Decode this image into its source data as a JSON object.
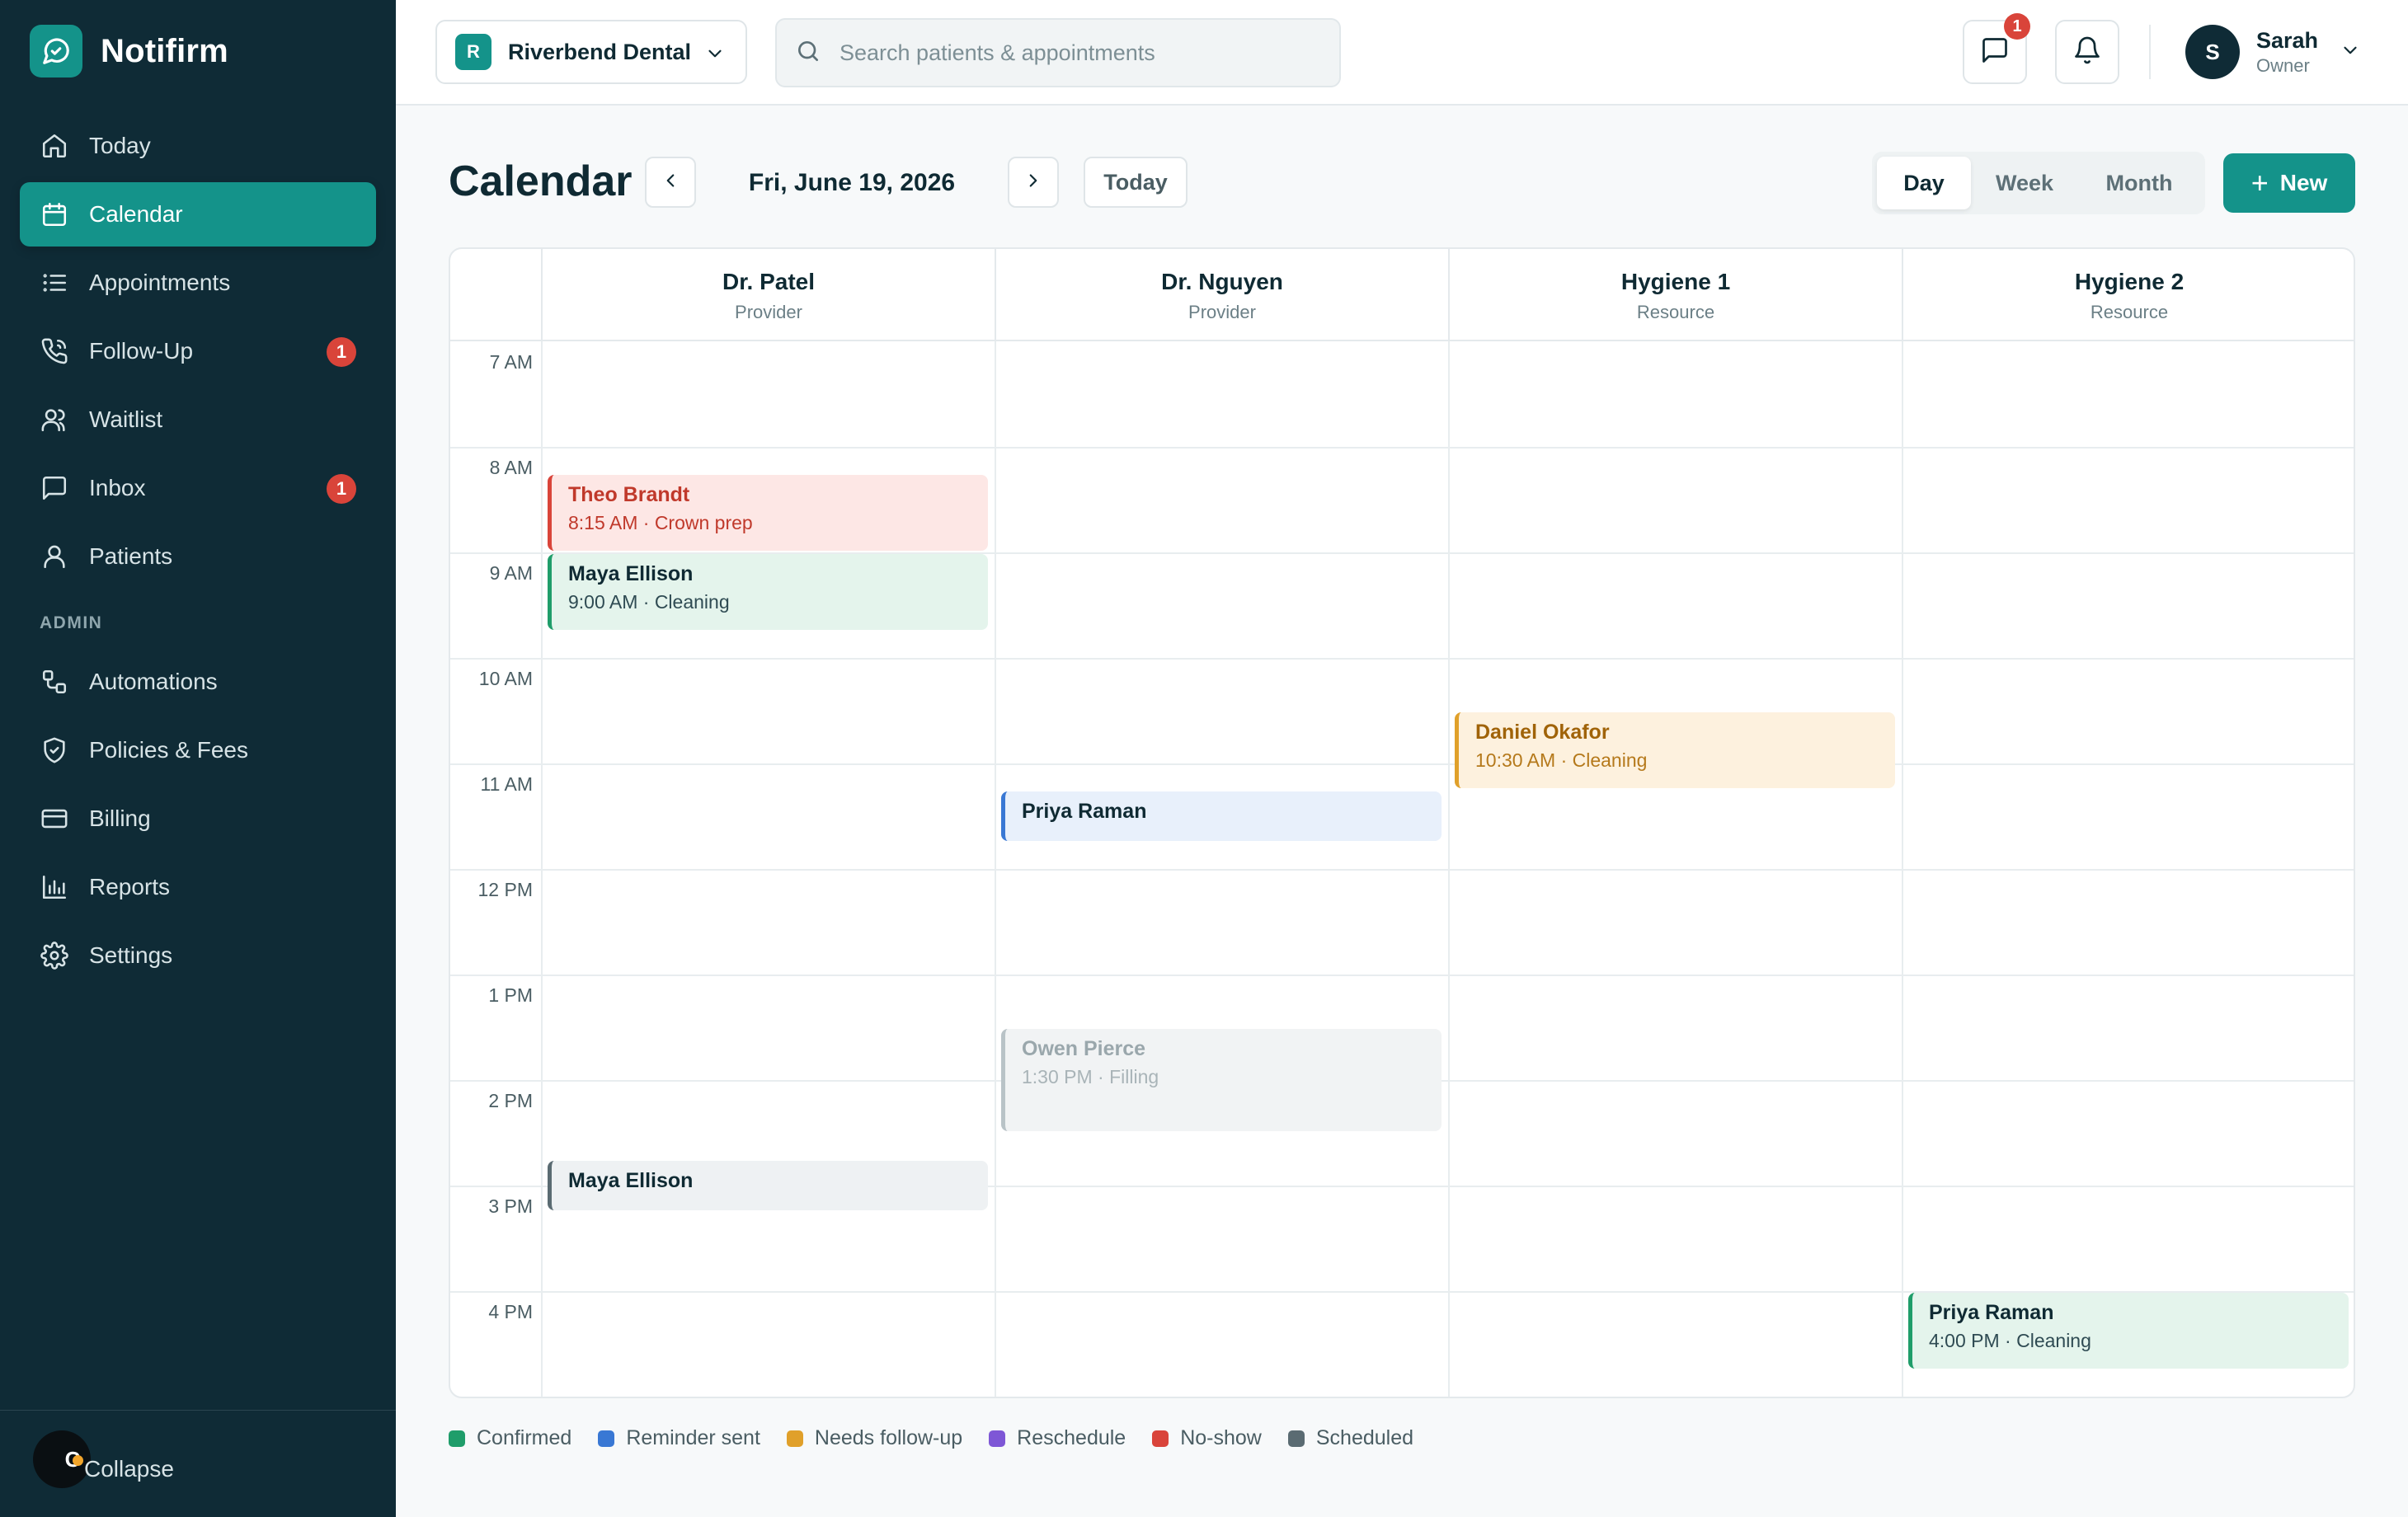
{
  "brand": {
    "name": "Notifirm"
  },
  "sidebar": {
    "items": [
      {
        "label": "Today",
        "icon": "home-icon"
      },
      {
        "label": "Calendar",
        "icon": "calendar-icon",
        "active": true
      },
      {
        "label": "Appointments",
        "icon": "list-icon"
      },
      {
        "label": "Follow-Up",
        "icon": "phone-icon",
        "badge": "1"
      },
      {
        "label": "Waitlist",
        "icon": "users-icon"
      },
      {
        "label": "Inbox",
        "icon": "message-icon",
        "badge": "1"
      },
      {
        "label": "Patients",
        "icon": "user-icon"
      }
    ],
    "admin_section": "ADMIN",
    "admin_items": [
      {
        "label": "Automations",
        "icon": "workflow-icon"
      },
      {
        "label": "Policies & Fees",
        "icon": "shield-icon"
      },
      {
        "label": "Billing",
        "icon": "credit-card-icon"
      },
      {
        "label": "Reports",
        "icon": "bar-chart-icon"
      },
      {
        "label": "Settings",
        "icon": "gear-icon"
      }
    ],
    "collapse_avatar": "C",
    "collapse_label": "Collapse"
  },
  "topbar": {
    "practice_initial": "R",
    "practice_name": "Riverbend Dental",
    "search_placeholder": "Search patients & appointments",
    "messages_badge": "1",
    "user_initial": "S",
    "user_name": "Sarah",
    "user_role": "Owner"
  },
  "calendar": {
    "title": "Calendar",
    "date": "Fri, June 19, 2026",
    "today_label": "Today",
    "views": [
      "Day",
      "Week",
      "Month"
    ],
    "active_view": "Day",
    "new_label": "New",
    "columns": [
      {
        "name": "Dr. Patel",
        "type": "Provider"
      },
      {
        "name": "Dr. Nguyen",
        "type": "Provider"
      },
      {
        "name": "Hygiene 1",
        "type": "Resource"
      },
      {
        "name": "Hygiene 2",
        "type": "Resource"
      }
    ],
    "hours": [
      "7 AM",
      "8 AM",
      "9 AM",
      "10 AM",
      "11 AM",
      "12 PM",
      "1 PM",
      "2 PM",
      "3 PM",
      "4 PM"
    ],
    "appointments": [
      {
        "patient": "Theo Brandt",
        "meta": "8:15 AM · Crown prep",
        "column": 0,
        "start": 8.25,
        "end": 9.0,
        "status": "noshow"
      },
      {
        "patient": "Maya Ellison",
        "meta": "9:00 AM · Cleaning",
        "column": 0,
        "start": 9.0,
        "end": 9.75,
        "status": "confirmed"
      },
      {
        "patient": "Daniel Okafor",
        "meta": "10:30 AM · Cleaning",
        "column": 2,
        "start": 10.5,
        "end": 11.25,
        "status": "followup"
      },
      {
        "patient": "Priya Raman",
        "meta": "",
        "column": 1,
        "start": 11.25,
        "end": 11.75,
        "status": "reminder"
      },
      {
        "patient": "Owen Pierce",
        "meta": "1:30 PM · Filling",
        "column": 1,
        "start": 13.5,
        "end": 14.5,
        "status": "faded"
      },
      {
        "patient": "Maya Ellison",
        "meta": "",
        "column": 0,
        "start": 14.75,
        "end": 15.25,
        "status": "scheduled"
      },
      {
        "patient": "Priya Raman",
        "meta": "4:00 PM · Cleaning",
        "column": 3,
        "start": 16.0,
        "end": 16.75,
        "status": "confirmed"
      }
    ]
  },
  "legend": [
    {
      "label": "Confirmed",
      "color": "#1f9d6a"
    },
    {
      "label": "Reminder sent",
      "color": "#3978d4"
    },
    {
      "label": "Needs follow-up",
      "color": "#e0a02a"
    },
    {
      "label": "Reschedule",
      "color": "#7e57d6"
    },
    {
      "label": "No-show",
      "color": "#d9443a"
    },
    {
      "label": "Scheduled",
      "color": "#5a6b72"
    }
  ]
}
